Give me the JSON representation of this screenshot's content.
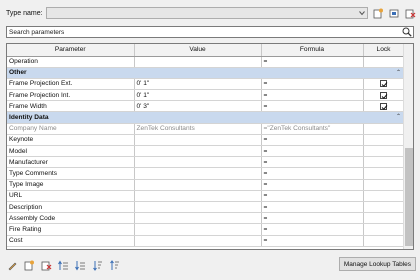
{
  "type_row": {
    "label": "Type name:"
  },
  "search": {
    "placeholder": "Search parameters"
  },
  "columns": [
    "Parameter",
    "Value",
    "Formula",
    "Lock"
  ],
  "rows": [
    {
      "kind": "row",
      "param": "Operation",
      "value": "",
      "formula": "=",
      "lock": null
    },
    {
      "kind": "group",
      "label": "Other"
    },
    {
      "kind": "row",
      "param": "Frame Projection Ext.",
      "value": "0'  1\"",
      "formula": "=",
      "lock": true
    },
    {
      "kind": "row",
      "param": "Frame Projection Int.",
      "value": "0'  1\"",
      "formula": "=",
      "lock": true
    },
    {
      "kind": "row",
      "param": "Frame Width",
      "value": "0'  3\"",
      "formula": "=",
      "lock": true
    },
    {
      "kind": "group",
      "label": "Identity Data"
    },
    {
      "kind": "row",
      "dim": true,
      "param": "Company Name",
      "value": "ZenTek Consultants",
      "formula": "=\"ZenTek Consultants\"",
      "lock": null
    },
    {
      "kind": "row",
      "param": "Keynote",
      "value": "",
      "formula": "=",
      "lock": null
    },
    {
      "kind": "row",
      "param": "Model",
      "value": "",
      "formula": "=",
      "lock": null
    },
    {
      "kind": "row",
      "param": "Manufacturer",
      "value": "",
      "formula": "=",
      "lock": null
    },
    {
      "kind": "row",
      "param": "Type Comments",
      "value": "",
      "formula": "=",
      "lock": null
    },
    {
      "kind": "row",
      "param": "Type Image",
      "value": "",
      "formula": "=",
      "lock": null
    },
    {
      "kind": "row",
      "param": "URL",
      "value": "",
      "formula": "=",
      "lock": null
    },
    {
      "kind": "row",
      "param": "Description",
      "value": "",
      "formula": "=",
      "lock": null
    },
    {
      "kind": "row",
      "param": "Assembly Code",
      "value": "",
      "formula": "=",
      "lock": null
    },
    {
      "kind": "row",
      "param": "Fire Rating",
      "value": "",
      "formula": "=",
      "lock": null
    },
    {
      "kind": "row",
      "param": "Cost",
      "value": "",
      "formula": "=",
      "lock": null
    }
  ],
  "collapse_glyph": "⌃",
  "bottom": {
    "lookup_button": "Manage Lookup Tables"
  },
  "colors": {
    "group_bg": "#c9d9ee",
    "grid_border": "#7a7a7a"
  }
}
